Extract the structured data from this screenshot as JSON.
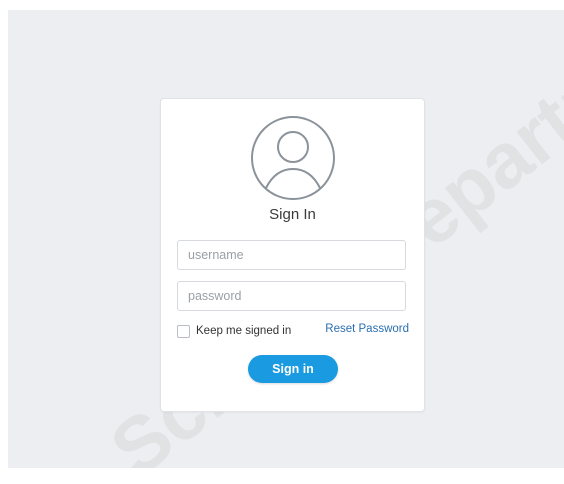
{
  "login": {
    "title": "Sign In",
    "username_placeholder": "username",
    "password_placeholder": "password",
    "keep_signed_in_label": "Keep me signed in",
    "keep_signed_in_checked": false,
    "reset_password_label": "Reset Password",
    "signin_button_label": "Sign in",
    "avatar_icon": "user-circle-icon"
  },
  "colors": {
    "background": "#eceef2",
    "card": "#ffffff",
    "accent": "#1a9ae0",
    "link": "#2a6fb0",
    "watermark": "#d9d9d9"
  },
  "watermark": {
    "text": "Science Department Maharashtra"
  }
}
